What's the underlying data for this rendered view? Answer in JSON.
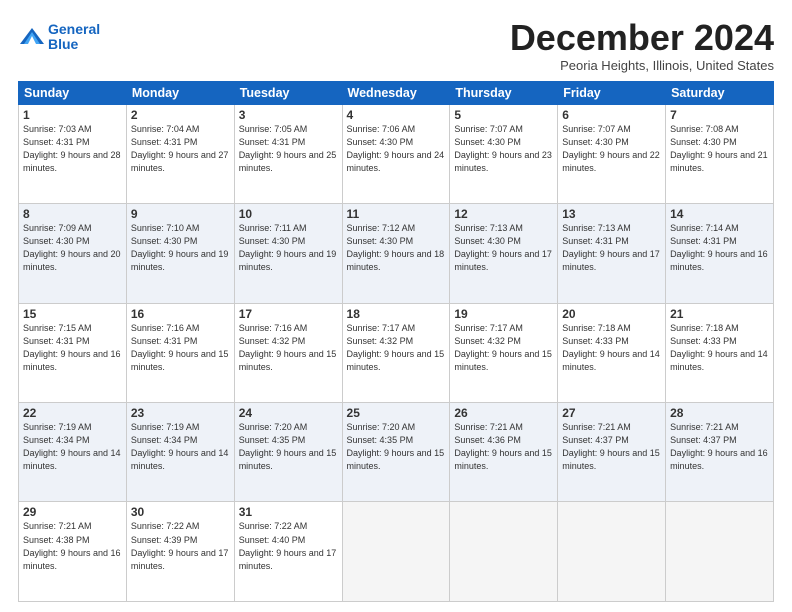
{
  "header": {
    "logo_line1": "General",
    "logo_line2": "Blue",
    "month_title": "December 2024",
    "location": "Peoria Heights, Illinois, United States"
  },
  "calendar": {
    "days_of_week": [
      "Sunday",
      "Monday",
      "Tuesday",
      "Wednesday",
      "Thursday",
      "Friday",
      "Saturday"
    ],
    "weeks": [
      [
        {
          "day": 1,
          "sunrise": "7:03 AM",
          "sunset": "4:31 PM",
          "daylight": "9 hours and 28 minutes."
        },
        {
          "day": 2,
          "sunrise": "7:04 AM",
          "sunset": "4:31 PM",
          "daylight": "9 hours and 27 minutes."
        },
        {
          "day": 3,
          "sunrise": "7:05 AM",
          "sunset": "4:31 PM",
          "daylight": "9 hours and 25 minutes."
        },
        {
          "day": 4,
          "sunrise": "7:06 AM",
          "sunset": "4:30 PM",
          "daylight": "9 hours and 24 minutes."
        },
        {
          "day": 5,
          "sunrise": "7:07 AM",
          "sunset": "4:30 PM",
          "daylight": "9 hours and 23 minutes."
        },
        {
          "day": 6,
          "sunrise": "7:07 AM",
          "sunset": "4:30 PM",
          "daylight": "9 hours and 22 minutes."
        },
        {
          "day": 7,
          "sunrise": "7:08 AM",
          "sunset": "4:30 PM",
          "daylight": "9 hours and 21 minutes."
        }
      ],
      [
        {
          "day": 8,
          "sunrise": "7:09 AM",
          "sunset": "4:30 PM",
          "daylight": "9 hours and 20 minutes."
        },
        {
          "day": 9,
          "sunrise": "7:10 AM",
          "sunset": "4:30 PM",
          "daylight": "9 hours and 19 minutes."
        },
        {
          "day": 10,
          "sunrise": "7:11 AM",
          "sunset": "4:30 PM",
          "daylight": "9 hours and 19 minutes."
        },
        {
          "day": 11,
          "sunrise": "7:12 AM",
          "sunset": "4:30 PM",
          "daylight": "9 hours and 18 minutes."
        },
        {
          "day": 12,
          "sunrise": "7:13 AM",
          "sunset": "4:30 PM",
          "daylight": "9 hours and 17 minutes."
        },
        {
          "day": 13,
          "sunrise": "7:13 AM",
          "sunset": "4:31 PM",
          "daylight": "9 hours and 17 minutes."
        },
        {
          "day": 14,
          "sunrise": "7:14 AM",
          "sunset": "4:31 PM",
          "daylight": "9 hours and 16 minutes."
        }
      ],
      [
        {
          "day": 15,
          "sunrise": "7:15 AM",
          "sunset": "4:31 PM",
          "daylight": "9 hours and 16 minutes."
        },
        {
          "day": 16,
          "sunrise": "7:16 AM",
          "sunset": "4:31 PM",
          "daylight": "9 hours and 15 minutes."
        },
        {
          "day": 17,
          "sunrise": "7:16 AM",
          "sunset": "4:32 PM",
          "daylight": "9 hours and 15 minutes."
        },
        {
          "day": 18,
          "sunrise": "7:17 AM",
          "sunset": "4:32 PM",
          "daylight": "9 hours and 15 minutes."
        },
        {
          "day": 19,
          "sunrise": "7:17 AM",
          "sunset": "4:32 PM",
          "daylight": "9 hours and 15 minutes."
        },
        {
          "day": 20,
          "sunrise": "7:18 AM",
          "sunset": "4:33 PM",
          "daylight": "9 hours and 14 minutes."
        },
        {
          "day": 21,
          "sunrise": "7:18 AM",
          "sunset": "4:33 PM",
          "daylight": "9 hours and 14 minutes."
        }
      ],
      [
        {
          "day": 22,
          "sunrise": "7:19 AM",
          "sunset": "4:34 PM",
          "daylight": "9 hours and 14 minutes."
        },
        {
          "day": 23,
          "sunrise": "7:19 AM",
          "sunset": "4:34 PM",
          "daylight": "9 hours and 14 minutes."
        },
        {
          "day": 24,
          "sunrise": "7:20 AM",
          "sunset": "4:35 PM",
          "daylight": "9 hours and 15 minutes."
        },
        {
          "day": 25,
          "sunrise": "7:20 AM",
          "sunset": "4:35 PM",
          "daylight": "9 hours and 15 minutes."
        },
        {
          "day": 26,
          "sunrise": "7:21 AM",
          "sunset": "4:36 PM",
          "daylight": "9 hours and 15 minutes."
        },
        {
          "day": 27,
          "sunrise": "7:21 AM",
          "sunset": "4:37 PM",
          "daylight": "9 hours and 15 minutes."
        },
        {
          "day": 28,
          "sunrise": "7:21 AM",
          "sunset": "4:37 PM",
          "daylight": "9 hours and 16 minutes."
        }
      ],
      [
        {
          "day": 29,
          "sunrise": "7:21 AM",
          "sunset": "4:38 PM",
          "daylight": "9 hours and 16 minutes."
        },
        {
          "day": 30,
          "sunrise": "7:22 AM",
          "sunset": "4:39 PM",
          "daylight": "9 hours and 17 minutes."
        },
        {
          "day": 31,
          "sunrise": "7:22 AM",
          "sunset": "4:40 PM",
          "daylight": "9 hours and 17 minutes."
        },
        null,
        null,
        null,
        null
      ]
    ]
  }
}
